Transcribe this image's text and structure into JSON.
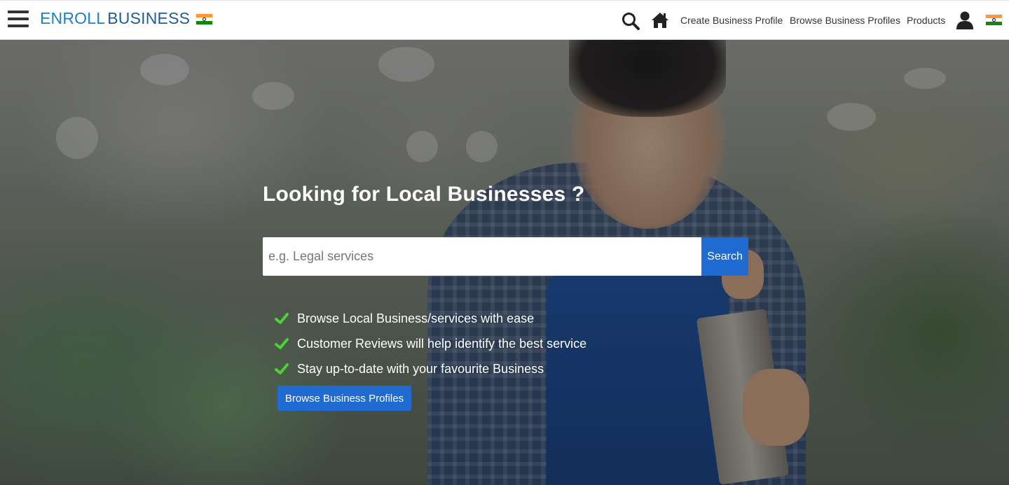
{
  "header": {
    "brand_part1": "ENROLL",
    "brand_part2": "BUSINESS",
    "nav_links": [
      "Create Business Profile",
      "Browse Business Profiles",
      "Products"
    ]
  },
  "icons": {
    "menu": "hamburger-icon",
    "search": "search-icon",
    "home": "home-icon",
    "user": "user-icon",
    "flag": "india-flag-icon",
    "check": "check-icon"
  },
  "hero": {
    "title": "Looking for Local Businesses ?",
    "search": {
      "placeholder": "e.g. Legal services",
      "value": "",
      "button_label": "Search"
    },
    "features": [
      "Browse Local Business/services with ease",
      "Customer Reviews will help identify the best service",
      "Stay up-to-date with your favourite Business"
    ],
    "cta_label": "Browse Business Profiles"
  },
  "colors": {
    "brand_blue": "#1a82c4",
    "button_blue": "#1f6bd1",
    "check_green": "#4cd137",
    "header_text": "#333333"
  }
}
